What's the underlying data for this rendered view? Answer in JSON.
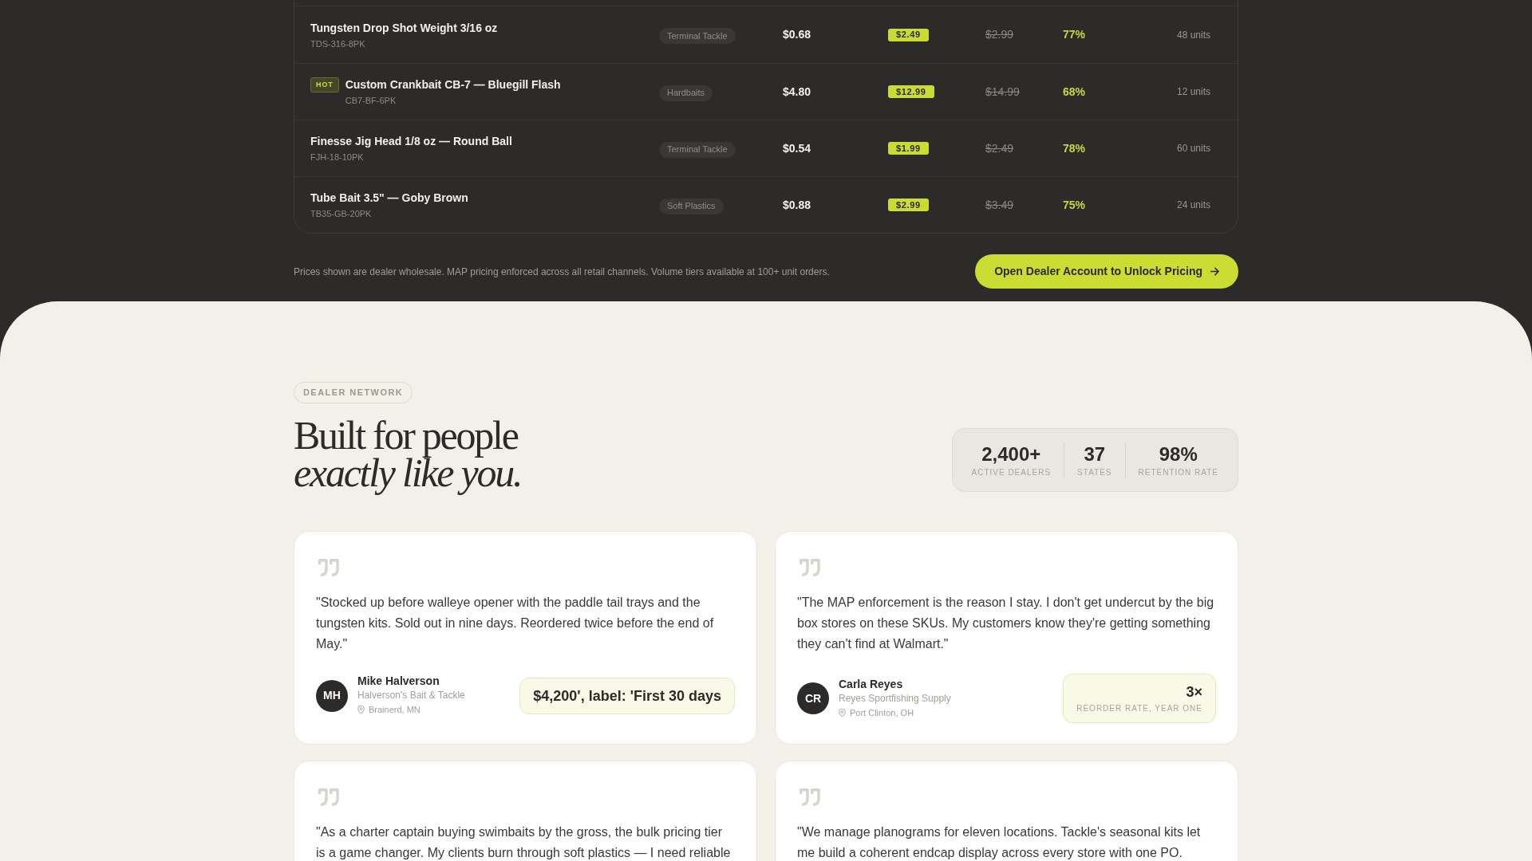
{
  "pricing_table": {
    "rows": [
      {
        "title": "Tungsten Drop Shot Weight 3/16 oz",
        "code": "TDS-316-8PK",
        "tag": "Terminal Tackle",
        "price": "$0.68",
        "highlighted_price": "$2.49",
        "struck_price": "$2.99",
        "percent": "77%",
        "quantity": "48 units"
      },
      {
        "badge": "HOT",
        "title": "Custom Crankbait CB-7 — Bluegill Flash",
        "code": "CB7-BF-6PK",
        "tag": "Hardbaits",
        "price": "$4.80",
        "highlighted_price": "$12.99",
        "struck_price": "$14.99",
        "percent": "68%",
        "quantity": "12 units"
      },
      {
        "title": "Finesse Jig Head 1/8 oz — Round Ball",
        "code": "FJH-18-10PK",
        "tag": "Terminal Tackle",
        "price": "$0.54",
        "highlighted_price": "$1.99",
        "struck_price": "$2.49",
        "percent": "78%",
        "quantity": "60 units"
      },
      {
        "title": "Tube Bait 3.5\" — Goby Brown",
        "code": "TB35-GB-20PK",
        "tag": "Soft Plastics",
        "price": "$0.88",
        "highlighted_price": "$2.99",
        "struck_price": "$3.49",
        "percent": "75%",
        "quantity": "24 units"
      }
    ]
  },
  "pricing_note": "Prices shown are dealer wholesale. MAP pricing enforced across all retail channels. Volume tiers available at 100+ unit orders.",
  "cta_button": {
    "label": "Open Dealer Account to Unlock Pricing"
  },
  "dealer_section": {
    "eyebrow": "DEALER NETWORK",
    "heading": [
      {
        "text": "Built for people",
        "italic": false
      },
      {
        "text": "exactly like you.",
        "italic": true
      }
    ],
    "stats": [
      {
        "value": "2,400+",
        "label": "ACTIVE DEALERS"
      },
      {
        "value": "37",
        "label": "STATES"
      },
      {
        "value": "98%",
        "label": "RETENTION RATE"
      }
    ],
    "testimonials": [
      {
        "quote": "\"Stocked up before walleye opener with the paddle tail trays and the tungsten kits. Sold out in nine days. Reordered twice before the end of May.\"",
        "author": {
          "initials": "MH",
          "name": "Mike Halverson",
          "company": "Halverson's Bait & Tackle",
          "location": "Brainerd, MN"
        },
        "metric": {
          "value": "$4,200', label: 'First 30 days"
        }
      },
      {
        "quote": "\"The MAP enforcement is the reason I stay. I don't get undercut by the big box stores on these SKUs. My customers know they're getting something they can't find at Walmart.\"",
        "author": {
          "initials": "CR",
          "name": "Carla Reyes",
          "company": "Reyes Sportfishing Supply",
          "location": "Port Clinton, OH"
        },
        "metric": {
          "value": "3×",
          "label": "REORDER RATE, YEAR ONE"
        }
      },
      {
        "quote": "\"As a charter captain buying swimbaits by the gross, the bulk pricing tier is a game changer. My clients burn through soft plastics — I need reliable"
      },
      {
        "quote": "\"We manage planograms for eleven locations. Tackle's seasonal kits let me build a coherent endcap display across every store with one PO."
      }
    ]
  }
}
